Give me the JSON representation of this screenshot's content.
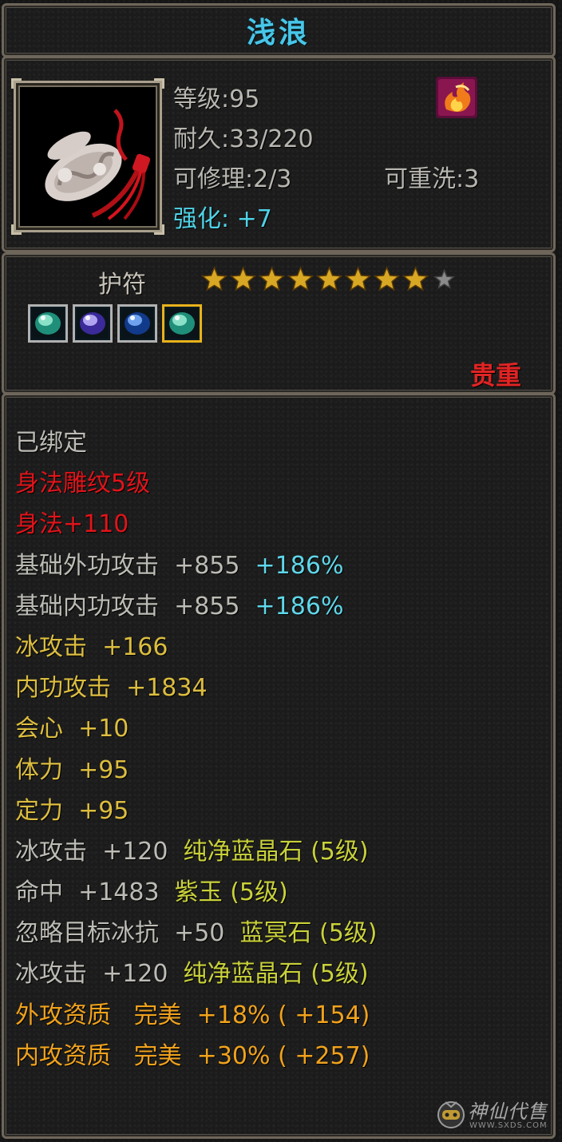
{
  "item": {
    "name": "浅浪",
    "level_line": "等级:95",
    "durability_line": "耐久:33/220",
    "repairable_line": "可修理:2/3",
    "rewashable_line": "可重洗:3",
    "enhance_line": "强化: +7",
    "icon": "jade-pendant-icon",
    "badge_icon": "flame-badge-icon"
  },
  "amulet": {
    "label": "护符",
    "stars_filled": 8,
    "stars_total": 9,
    "gems": [
      {
        "icon": "green-gem-icon",
        "selected": false
      },
      {
        "icon": "purple-gem-icon",
        "selected": false
      },
      {
        "icon": "blue-gem-icon",
        "selected": false
      },
      {
        "icon": "green-gem-icon",
        "selected": true
      }
    ],
    "rarity": "贵重"
  },
  "attributes": [
    {
      "parts": [
        {
          "text": "已绑定",
          "color": "white"
        }
      ]
    },
    {
      "parts": [
        {
          "text": "身法雕纹5级",
          "color": "red"
        }
      ]
    },
    {
      "parts": [
        {
          "text": "身法+110",
          "color": "red"
        }
      ]
    },
    {
      "parts": [
        {
          "text": "基础外功攻击  +855  ",
          "color": "white"
        },
        {
          "text": "+186%",
          "color": "cyan"
        }
      ]
    },
    {
      "parts": [
        {
          "text": "基础内功攻击  +855  ",
          "color": "white"
        },
        {
          "text": "+186%",
          "color": "cyan"
        }
      ]
    },
    {
      "parts": [
        {
          "text": "冰攻击  +166",
          "color": "gold"
        }
      ]
    },
    {
      "parts": [
        {
          "text": "内功攻击  +1834",
          "color": "gold"
        }
      ]
    },
    {
      "parts": [
        {
          "text": "会心  +10",
          "color": "gold"
        }
      ]
    },
    {
      "parts": [
        {
          "text": "体力  +95",
          "color": "gold"
        }
      ]
    },
    {
      "parts": [
        {
          "text": "定力  +95",
          "color": "gold"
        }
      ]
    },
    {
      "parts": [
        {
          "text": "冰攻击  +120  ",
          "color": "white"
        },
        {
          "text": "纯净蓝晶石 (5级)",
          "color": "yellow"
        }
      ]
    },
    {
      "parts": [
        {
          "text": "命中  +1483  ",
          "color": "white"
        },
        {
          "text": "紫玉 (5级)",
          "color": "yellow"
        }
      ]
    },
    {
      "parts": [
        {
          "text": "忽略目标冰抗  +50  ",
          "color": "white"
        },
        {
          "text": "蓝冥石 (5级)",
          "color": "yellow"
        }
      ]
    },
    {
      "parts": [
        {
          "text": "冰攻击  +120  ",
          "color": "white"
        },
        {
          "text": "纯净蓝晶石 (5级)",
          "color": "yellow"
        }
      ]
    },
    {
      "parts": [
        {
          "text": "外攻资质   完美  +18% ( +154)",
          "color": "orange"
        }
      ]
    },
    {
      "parts": [
        {
          "text": "内攻资质   完美  +30% ( +257)",
          "color": "orange"
        }
      ]
    }
  ],
  "watermark": {
    "text": "神仙代售",
    "url": "WWW.SXDS.COM",
    "icon": "mascot-icon"
  },
  "colors": {
    "white": "#bdbbb5",
    "cyan": "#5fd7ea",
    "red": "#e0141a",
    "gold": "#dcbd3f",
    "yellow": "#c9d13a",
    "orange": "#f0a21c",
    "title": "#48c6e8",
    "star_filled": "#d8a825",
    "star_empty": "#8a8a8a"
  }
}
